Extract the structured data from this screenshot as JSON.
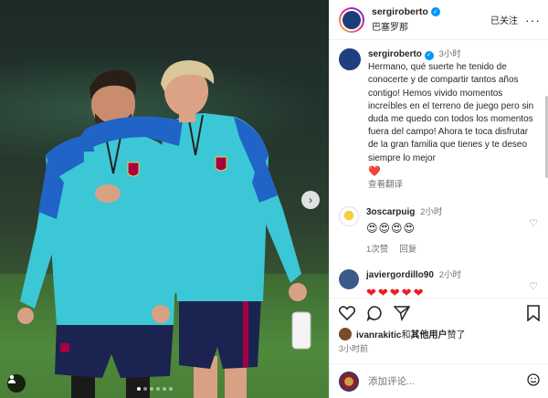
{
  "post": {
    "photo_alt": "",
    "carousel": {
      "dots": 6,
      "active": 0
    }
  },
  "header": {
    "username": "sergiroberto",
    "location": "巴塞罗那",
    "follow_label": "已关注",
    "more_label": "···"
  },
  "caption": {
    "username": "sergiroberto",
    "time": "3小时",
    "text": "Hermano, qué suerte he tenido de conocerte y de compartir tantos años contigo! Hemos vivido momentos increíbles en el terreno de juego pero sin duda me quedo con todos los momentos fuera del campo! Ahora te toca disfrutar de la gran familia que tienes y te deseo siempre lo mejor",
    "emoji": "❤️",
    "see_translation": "查看翻译"
  },
  "comments": [
    {
      "username": "3oscarpuig",
      "time": "2小时",
      "emojis": "😍😍😍😍",
      "likes": "1次赞",
      "reply": "回复"
    },
    {
      "username": "javiergordillo90",
      "time": "2小时",
      "emojis": "❤❤❤❤❤"
    }
  ],
  "liked_by": {
    "user": "ivanrakitic",
    "and": "和",
    "others": "其他用户",
    "suffix": "赞了"
  },
  "posted_ago": "3小时前",
  "add_comment_placeholder": "添加评论...",
  "colors": {
    "verified": "#0095f6",
    "heart": "#ed1c24",
    "kit_blue": "#3cc7d6",
    "shorts": "#1b2350"
  }
}
